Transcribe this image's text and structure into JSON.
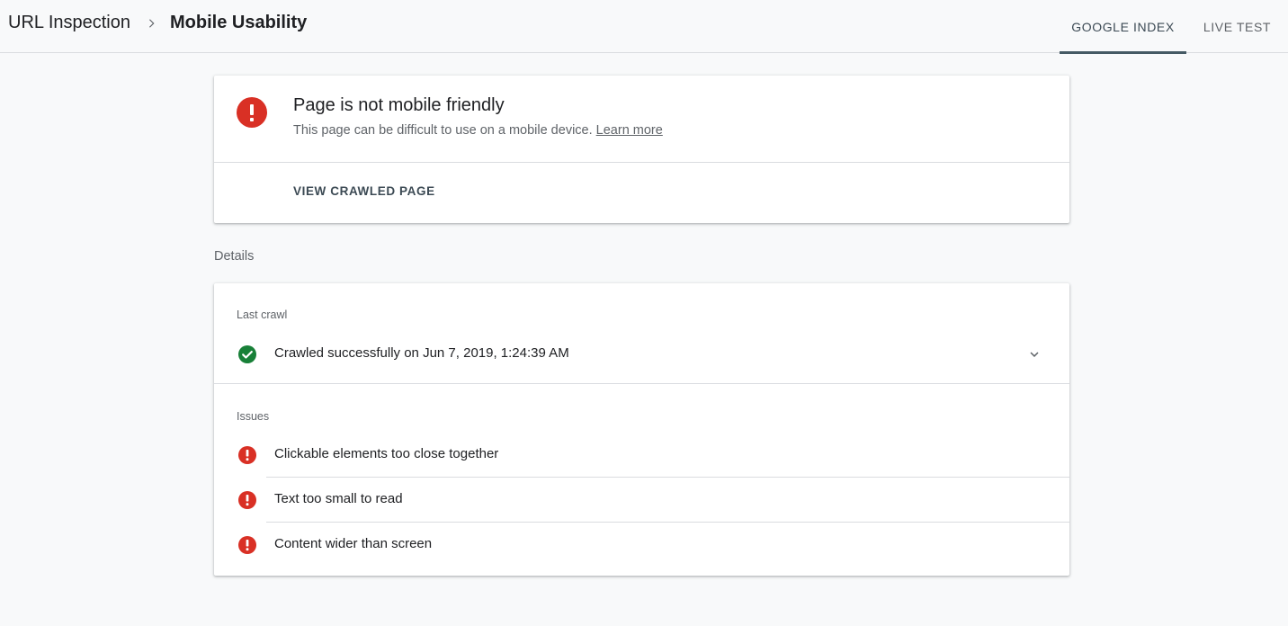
{
  "breadcrumb": {
    "root": "URL Inspection",
    "separator_icon": "chevron-right-icon",
    "current": "Mobile Usability"
  },
  "tabs": [
    {
      "label": "GOOGLE INDEX",
      "active": true
    },
    {
      "label": "LIVE TEST",
      "active": false
    }
  ],
  "status": {
    "icon": "error-icon",
    "title": "Page is not mobile friendly",
    "description": "This page can be difficult to use on a mobile device.",
    "learn_more": "Learn more",
    "action": "VIEW CRAWLED PAGE"
  },
  "details": {
    "heading": "Details",
    "last_crawl": {
      "label": "Last crawl",
      "icon": "check-circle-icon",
      "text": "Crawled successfully on Jun 7, 2019, 1:24:39 AM",
      "expand_icon": "chevron-down-icon"
    },
    "issues": {
      "label": "Issues",
      "items": [
        {
          "icon": "error-icon",
          "text": "Clickable elements too close together"
        },
        {
          "icon": "error-icon",
          "text": "Text too small to read"
        },
        {
          "icon": "error-icon",
          "text": "Content wider than screen"
        }
      ]
    }
  },
  "colors": {
    "error": "#d93025",
    "success": "#188038",
    "tab_indicator": "#455a64",
    "background": "#f8f9fa"
  }
}
